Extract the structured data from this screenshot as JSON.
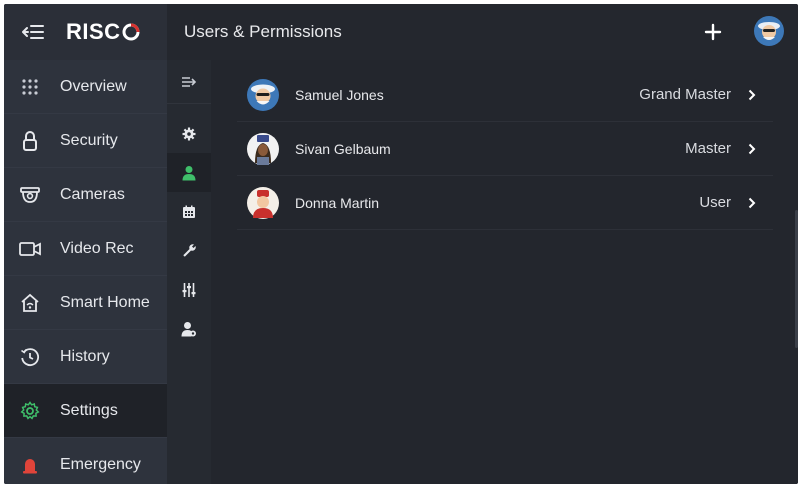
{
  "header": {
    "logo_text": "RISC",
    "title": "Users & Permissions"
  },
  "sidebar": {
    "items": [
      {
        "label": "Overview",
        "icon": "grid-icon"
      },
      {
        "label": "Security",
        "icon": "lock-icon"
      },
      {
        "label": "Cameras",
        "icon": "camera-icon"
      },
      {
        "label": "Video Rec",
        "icon": "video-icon"
      },
      {
        "label": "Smart Home",
        "icon": "home-icon"
      },
      {
        "label": "History",
        "icon": "history-icon"
      },
      {
        "label": "Settings",
        "icon": "gear-icon",
        "active": true
      },
      {
        "label": "Emergency",
        "icon": "siren-icon"
      }
    ]
  },
  "subrail": {
    "items": [
      "expand-icon",
      "gear-icon",
      "user-icon",
      "calendar-icon",
      "wrench-icon",
      "sliders-icon",
      "user-settings-icon"
    ],
    "active": "user-icon"
  },
  "users": [
    {
      "name": "Samuel Jones",
      "role": "Grand Master"
    },
    {
      "name": "Sivan Gelbaum",
      "role": "Master"
    },
    {
      "name": "Donna Martin",
      "role": "User"
    }
  ],
  "colors": {
    "accent_green": "#3fbf6a",
    "logo_red": "#d8322f",
    "emergency_red": "#e0443a"
  }
}
